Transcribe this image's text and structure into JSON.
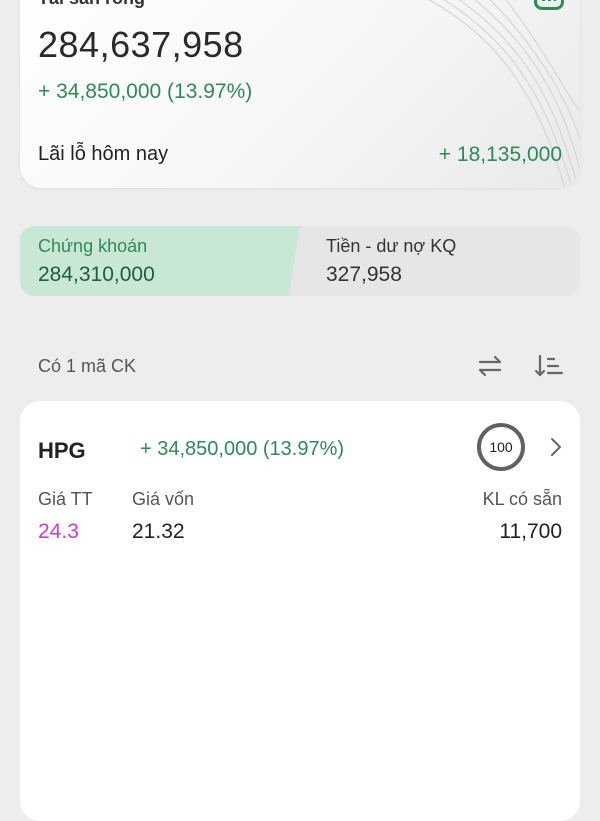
{
  "summary": {
    "total_label": "Tài sản ròng",
    "total_value": "284,637,958",
    "total_change": "+ 34,850,000 (13.97%)",
    "today_label": "Lãi lỗ hôm nay",
    "today_value": "+ 18,135,000"
  },
  "tabs": [
    {
      "label": "Chứng khoán",
      "value": "284,310,000",
      "active": true
    },
    {
      "label": "Tiền - dư nợ KQ",
      "value": "327,958",
      "active": false
    }
  ],
  "list": {
    "count_label": "Có 1 mã CK"
  },
  "holding": {
    "symbol": "HPG",
    "change": "+ 34,850,000 (13.97%)",
    "ratio": "100",
    "headers": {
      "market_price": "Giá TT",
      "cost_price": "Giá vốn",
      "available_qty": "KL có sẵn"
    },
    "values": {
      "market_price": "24.3",
      "cost_price": "21.32",
      "available_qty": "11,700"
    }
  },
  "colors": {
    "positive": "#2f8a55",
    "market_price": "#cc3ad2",
    "tab_active_bg": "#c9e7d5"
  },
  "icons": [
    "wallet-icon",
    "swap-icon",
    "sort-icon",
    "chevron-right-icon"
  ]
}
